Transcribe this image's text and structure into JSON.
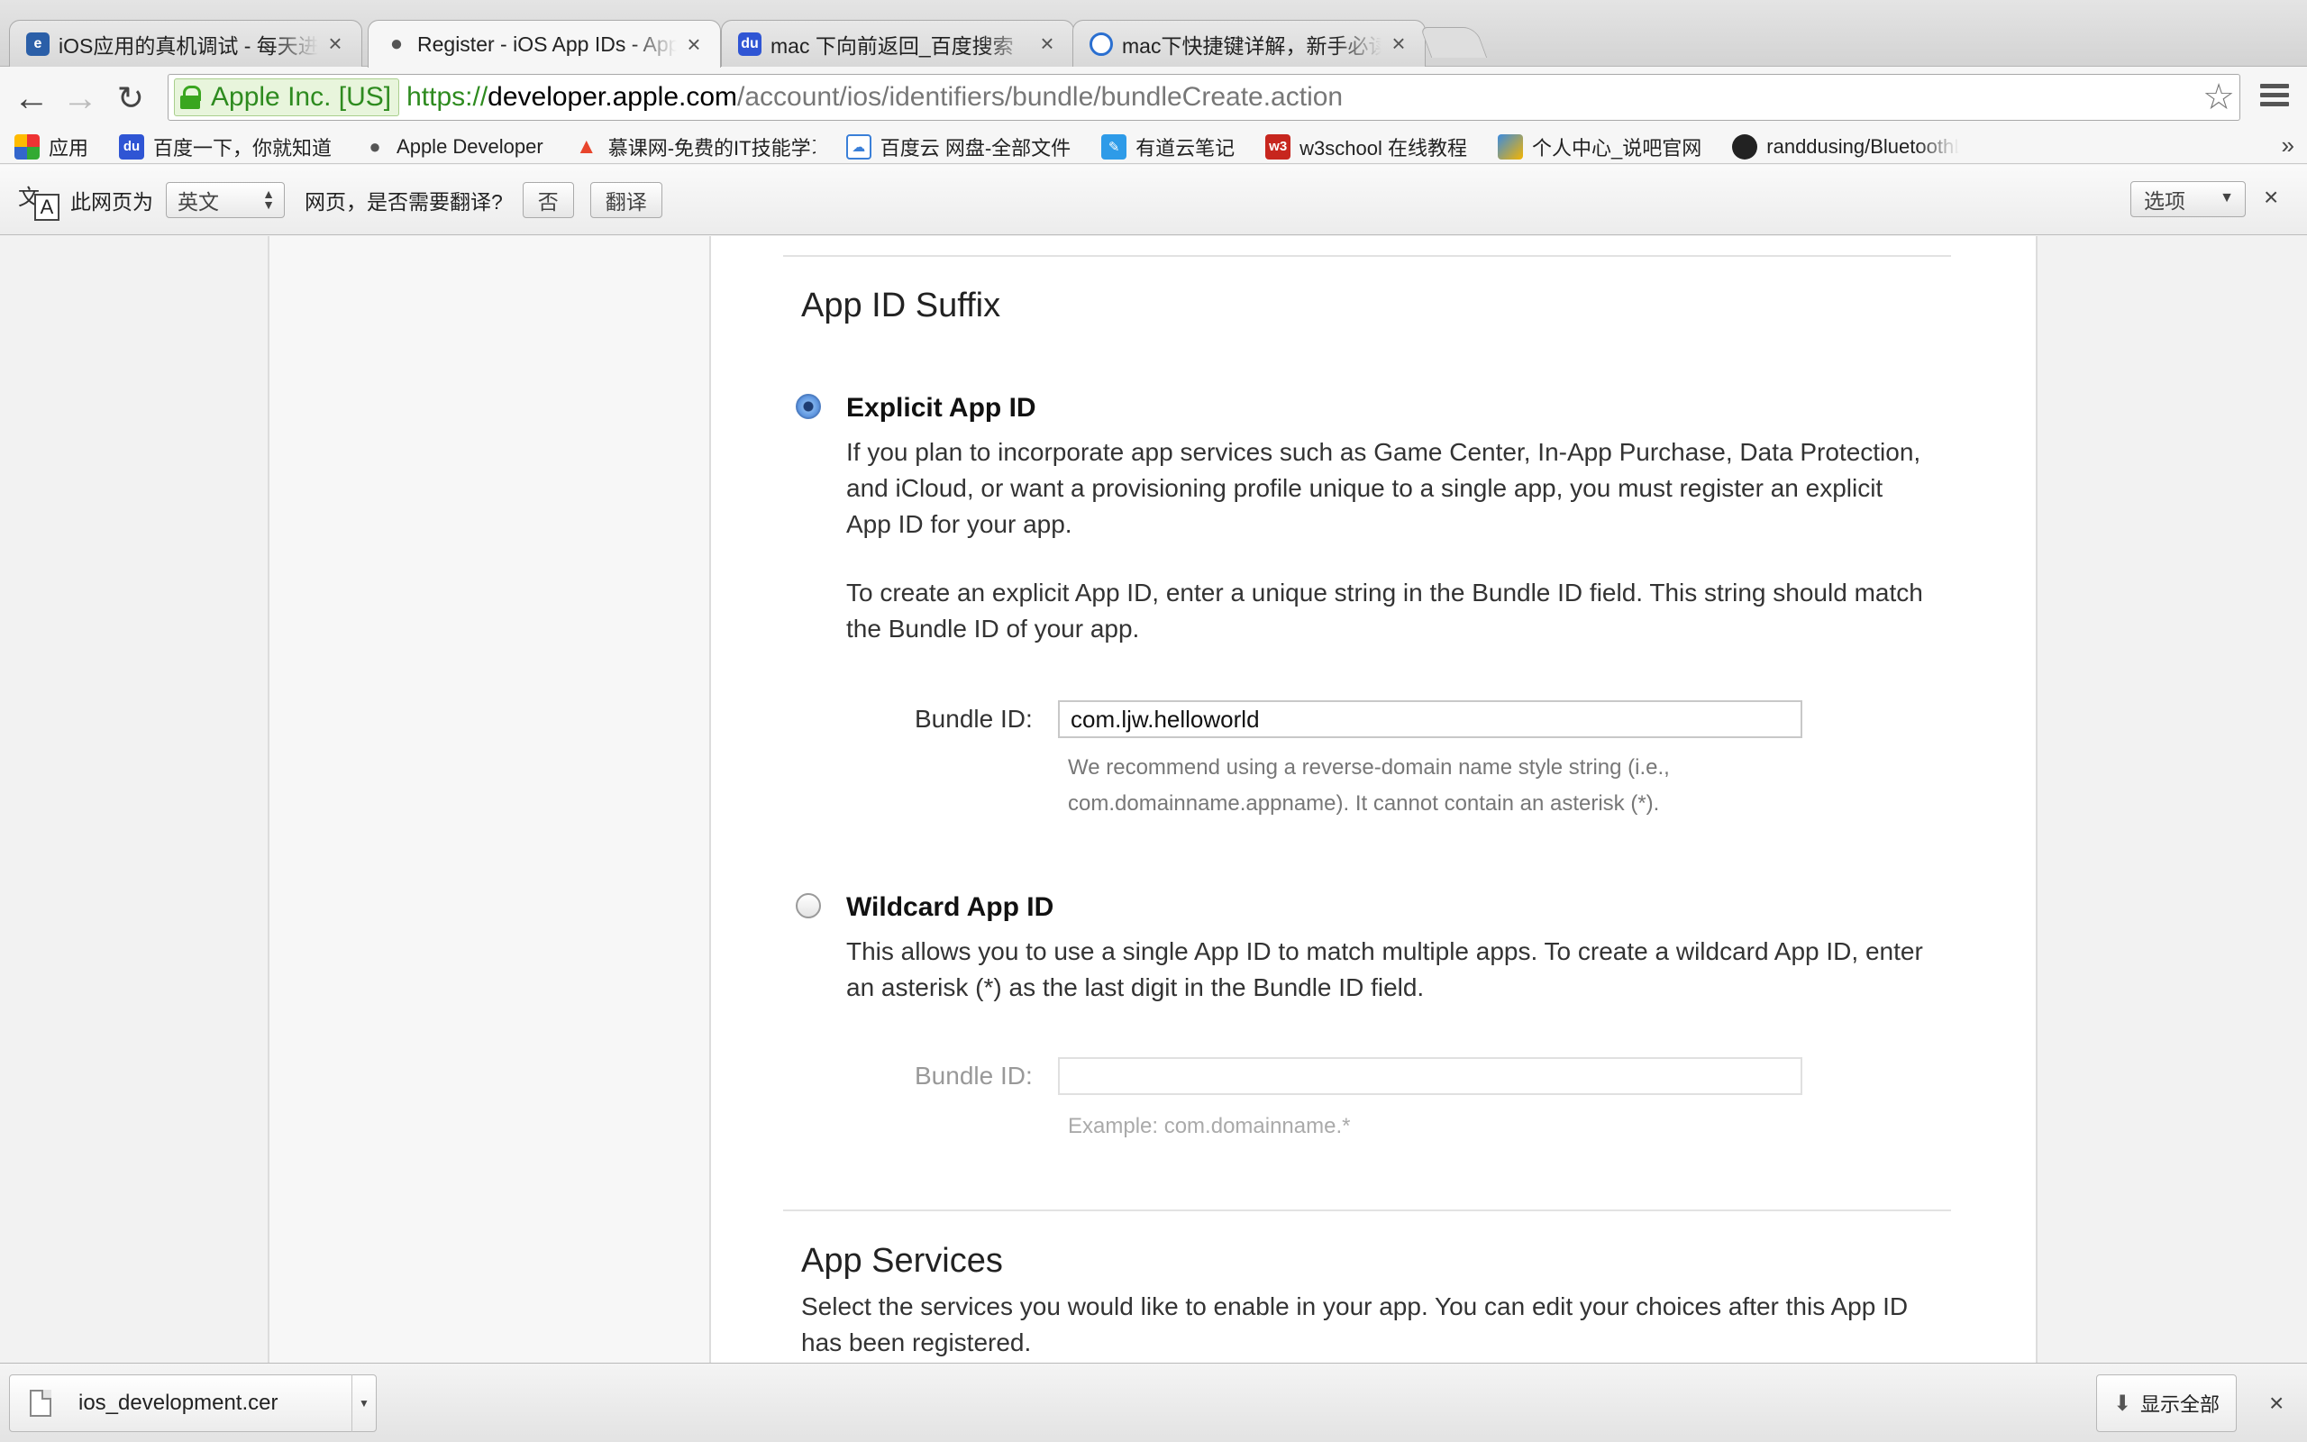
{
  "browser": {
    "tabs": [
      {
        "title": "iOS应用的真机调试 - 每天进步一点点",
        "icon": "e-icon",
        "color": "#2b5fa8"
      },
      {
        "title": "Register - iOS App IDs - Apple Developer",
        "icon": "apple-icon",
        "color": "#555555"
      },
      {
        "title": "mac 下向前返回_百度搜索",
        "icon": "baidu-paw-icon",
        "color": "#2f55d4"
      },
      {
        "title": "mac下快捷键详解，新手必读",
        "icon": "search-q-icon",
        "color": "#2a6fd0"
      }
    ],
    "address": {
      "ev_label": "Apple Inc. [US]",
      "scheme": "https://",
      "host": "developer.apple.com",
      "path": "/account/ios/identifiers/bundle/bundleCreate.action"
    },
    "bookmarks": [
      {
        "label": "应用",
        "icon": "apps-grid-icon"
      },
      {
        "label": "百度一下，你就知道",
        "icon": "baidu-paw-icon"
      },
      {
        "label": "Apple Developer",
        "icon": "apple-icon"
      },
      {
        "label": "慕课网-免费的IT技能学习",
        "icon": "flame-icon"
      },
      {
        "label": "百度云 网盘-全部文件",
        "icon": "cloud-icon"
      },
      {
        "label": "有道云笔记",
        "icon": "note-icon"
      },
      {
        "label": "w3school 在线教程",
        "icon": "w3-icon"
      },
      {
        "label": "个人中心_说吧官网",
        "icon": "puzzle-icon"
      },
      {
        "label": "randdusing/BluetoothLE",
        "icon": "github-icon"
      }
    ],
    "translate": {
      "prefix": "此网页为",
      "language": "英文",
      "question": "网页，是否需要翻译?",
      "no_label": "否",
      "translate_label": "翻译",
      "options_label": "选项"
    }
  },
  "page": {
    "suffix_heading": "App ID Suffix",
    "explicit": {
      "title": "Explicit App ID",
      "selected": true,
      "desc1": "If you plan to incorporate app services such as Game Center, In-App Purchase, Data Protection, and iCloud, or want a provisioning profile unique to a single app, you must register an explicit App ID for your app.",
      "desc2": "To create an explicit App ID, enter a unique string in the Bundle ID field. This string should match the Bundle ID of your app.",
      "bundle_label": "Bundle ID:",
      "bundle_value": "com.ljw.helloworld",
      "hint": "We recommend using a reverse-domain name style string (i.e., com.domainname.appname). It cannot contain an asterisk (*)."
    },
    "wildcard": {
      "title": "Wildcard App ID",
      "selected": false,
      "desc": "This allows you to use a single App ID to match multiple apps. To create a wildcard App ID, enter an asterisk (*) as the last digit in the Bundle ID field.",
      "bundle_label": "Bundle ID:",
      "bundle_value": "",
      "hint": "Example: com.domainname.*"
    },
    "services": {
      "heading": "App Services",
      "desc": "Select the services you would like to enable in your app. You can edit your choices after this App ID has been registered."
    }
  },
  "downloads": {
    "file_name": "ios_development.cer",
    "show_all_label": "显示全部"
  },
  "colors": {
    "ev_green": "#2e8b1f",
    "radio_selected": "#4d86d6"
  }
}
